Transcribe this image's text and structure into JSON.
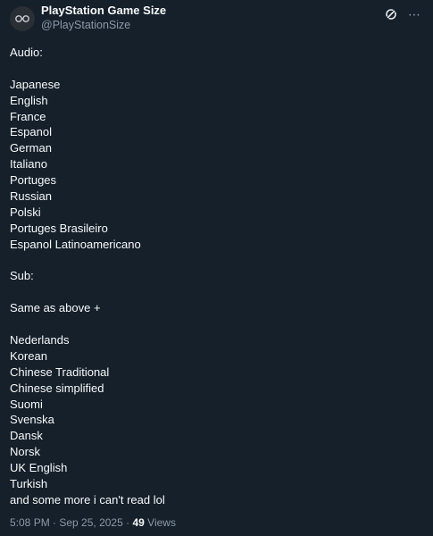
{
  "account": {
    "display_name": "PlayStation Game Size",
    "handle": "@PlayStationSize",
    "avatar_icon": "glasses-logo-icon"
  },
  "header_actions": {
    "grok_icon": "grok-icon",
    "more_icon": "more-icon",
    "more_glyph": "⋯"
  },
  "tweet": {
    "audio_heading": "Audio:",
    "audio_languages": [
      "Japanese",
      "English",
      "France",
      "Espanol",
      "German",
      "Italiano",
      "Portuges",
      "Russian",
      "Polski",
      "Portuges Brasileiro",
      "Espanol Latinoamericano"
    ],
    "sub_heading": "Sub:",
    "sub_intro": "Same as above +",
    "sub_languages": [
      "Nederlands",
      "Korean",
      "Chinese Traditional",
      "Chinese simplified",
      "Suomi",
      "Svenska",
      "Dansk",
      "Norsk",
      "UK English",
      "Turkish",
      "and some more i can't read lol"
    ]
  },
  "meta": {
    "time": "5:08 PM",
    "separator": " · ",
    "date": "Sep 25, 2025",
    "views_count": "49",
    "views_label": "Views"
  },
  "colors": {
    "background": "#15202b",
    "text_primary": "#f7f9f9",
    "text_secondary": "#8b98a5"
  }
}
